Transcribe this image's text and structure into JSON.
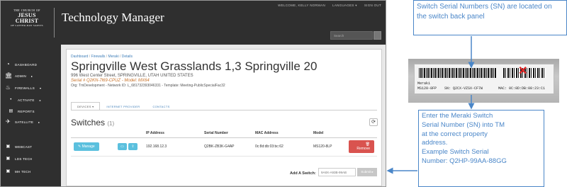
{
  "header": {
    "logo": {
      "line1": "THE CHURCH OF",
      "line2": "JESUS CHRIST",
      "line3": "OF LATTER-DAY SAINTS"
    },
    "app_title": "Technology Manager",
    "user_links": [
      "WELCOME, KELLY NORMAN",
      "LANGUAGES ▾",
      "SIGN OUT"
    ],
    "search_placeholder": "Search"
  },
  "sidebar": {
    "items": [
      {
        "label": "DASHBOARD",
        "icon": "dashboard-icon"
      },
      {
        "label": "ADMIN",
        "icon": "bank-icon",
        "caret": "▸"
      },
      {
        "label": "FIREWALLS",
        "icon": "firewall-icon",
        "caret": "▾"
      },
      {
        "label": "ACTIVATE",
        "icon": "dot-icon",
        "caret": "▸"
      },
      {
        "label": "REPORTS",
        "icon": "report-icon"
      },
      {
        "label": "SATELLITE",
        "icon": "satellite-icon",
        "caret": "▸"
      },
      {
        "label": "WEBCAST",
        "icon": "webcast-icon"
      },
      {
        "label": "LDS TECH",
        "icon": "tech-icon"
      },
      {
        "label": "MH TECH",
        "icon": "tech-icon"
      }
    ]
  },
  "main": {
    "breadcrumb": [
      "Dashboard",
      "Firewalls",
      "Meraki",
      "Details"
    ],
    "title": "Springville West Grasslands 1,3 Springville 20",
    "address": "996 West Center Street, SPRINGVILLE, UTAH UNITED STATES",
    "serial_line": "Serial # Q2KN-7l69-CPUZ - Model: MX64",
    "org_line": "Org: TmDevelopment - Network ID: L_681732393046331 - Template: Meeting-PublicSpecialFac32",
    "tabs": [
      "DEVICES ▾",
      "INTERNET PROVIDER",
      "CONTACTS"
    ],
    "switches_heading": "Switches",
    "switches_count": "(1)",
    "refresh_icon": "⟳",
    "table": {
      "headers": [
        "",
        "",
        "IP Address",
        "Serial Number",
        "MAC Address",
        "Model",
        ""
      ],
      "rows": [
        {
          "manage": "✎ Manage",
          "btn1": "▭",
          "btn2": "⇪",
          "ip": "192.168.12.3",
          "serial": "Q2BK-ZB3K-G4AP",
          "mac": "0c:8d:db:03:bc:62",
          "model": "MS120-8LP",
          "remove": "🗑 Remove"
        }
      ]
    },
    "add_switch_label": "Add A Switch:",
    "add_switch_placeholder": "9A8X-A93B-99AB",
    "submit_label": "Submit ▸"
  },
  "callouts": {
    "top": "Switch Serial Numbers (SN) are located on the switch back panel",
    "bottom_lines": [
      "Enter the Meraki Switch",
      "Serial Number (SN) into TM",
      "at the correct property",
      "address.",
      "Example Switch Serial",
      "Number: Q2HP-99AA-88GG"
    ]
  },
  "device_label": {
    "brand": "Meraki",
    "model": "MS120-8FP",
    "sn": "SN: Q2CX-VZSX-CF7W",
    "mac": "MAC: 0C:8D:DB:08:23:C1"
  },
  "colors": {
    "accent": "#4a86c8",
    "link": "#3f7eb8",
    "info_button": "#5bc0de",
    "danger_button": "#d9534f",
    "dark_chrome": "#2f2f2f"
  }
}
